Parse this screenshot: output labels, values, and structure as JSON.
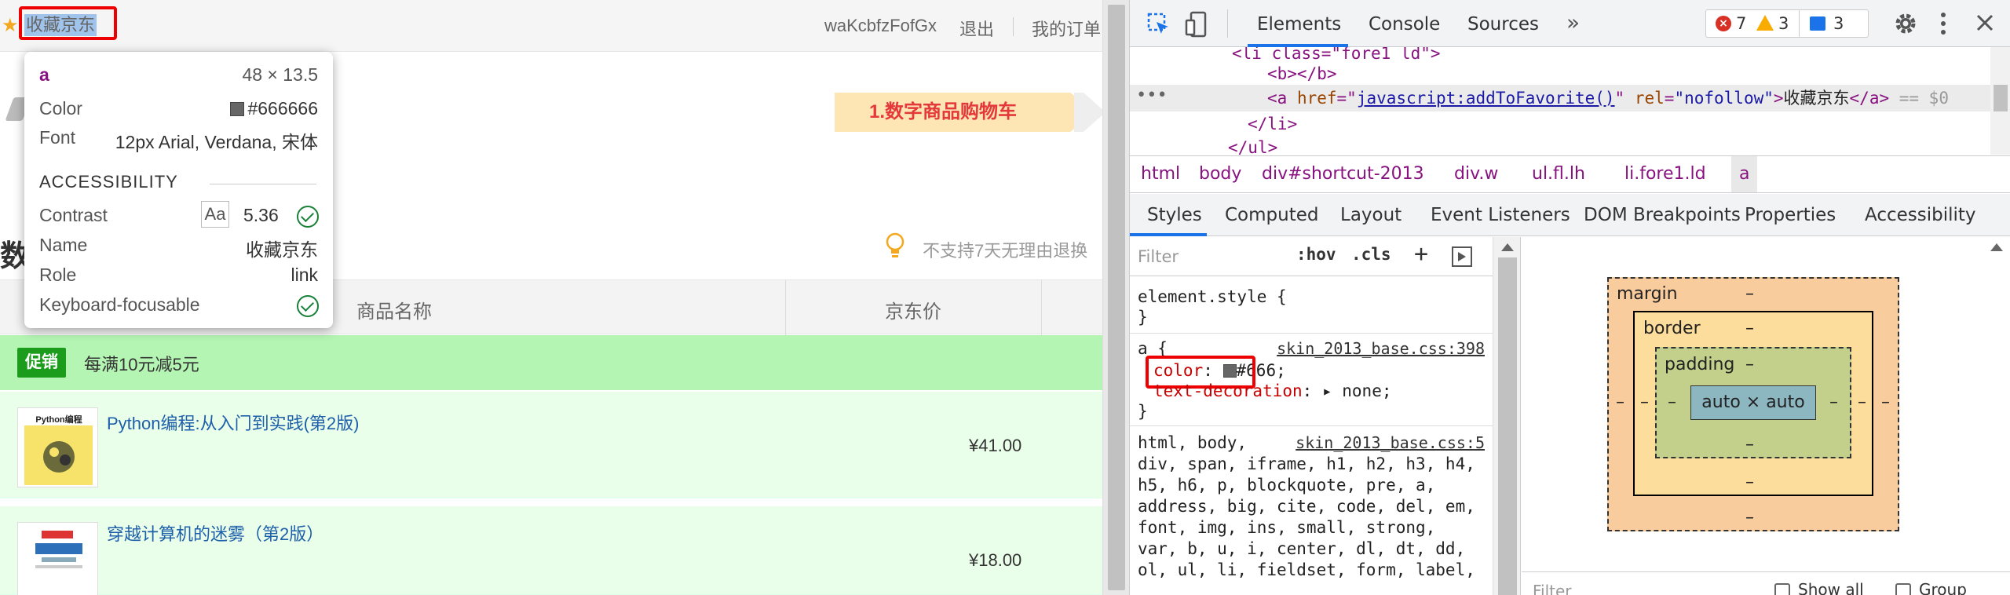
{
  "page": {
    "topbar": {
      "favorite": "收藏京东",
      "user_name": "waKcbfzFofGx",
      "logout": "退出",
      "my_orders": "我的订单"
    },
    "step1": "1.数字商品购物车",
    "section_title": "数",
    "no_return": "不支持7天无理由退换",
    "table": {
      "col_name": "商品名称",
      "col_price": "京东价"
    },
    "promo": {
      "badge": "促销",
      "text": "每满10元减5元"
    },
    "items": [
      {
        "title": "Python编程:从入门到实践(第2版)",
        "price": "¥41.00",
        "thumb_label": "Python编程"
      },
      {
        "title": "穿越计算机的迷雾（第2版）",
        "price": "¥18.00"
      }
    ],
    "tooltip": {
      "tag": "a",
      "size": "48 × 13.5",
      "color_label": "Color",
      "color_value": "#666666",
      "font_label": "Font",
      "font_value": "12px Arial, Verdana, 宋体",
      "accessibility": "ACCESSIBILITY",
      "contrast_label": "Contrast",
      "contrast_aa": "Aa",
      "contrast_value": "5.36",
      "name_label": "Name",
      "name_value": "收藏京东",
      "role_label": "Role",
      "role_value": "link",
      "kf_label": "Keyboard-focusable"
    }
  },
  "devtools": {
    "tabs": [
      "Elements",
      "Console",
      "Sources",
      "»"
    ],
    "errors": "7",
    "warnings": "3",
    "messages": "3",
    "dom": {
      "line1": "<li class=\"fore1 ld\">",
      "line2": "<b></b>",
      "line3_open": "<a ",
      "line3_href_attr": "href",
      "line3_href_val": "javascript:addToFavorite()",
      "line3_rel_attr": "rel",
      "line3_rel_val": "\"nofollow\"",
      "line3_text": "收藏京东",
      "line3_close": "</a>",
      "line3_eq": " == $0",
      "line4": "</li>",
      "line5": "</ul>"
    },
    "breadcrumb": [
      "html",
      "body",
      "div#shortcut-2013",
      "div.w",
      "ul.fl.lh",
      "li.fore1.ld",
      "a"
    ],
    "sub_tabs": [
      "Styles",
      "Computed",
      "Layout",
      "Event Listeners",
      "DOM Breakpoints",
      "Properties",
      "Accessibility"
    ],
    "styles": {
      "filter_placeholder": "Filter",
      "hov": ":hov",
      "cls": ".cls",
      "plus": "+",
      "element_style": "element.style {",
      "close_brace": "}",
      "rule_a_selector": "a {",
      "rule_a_source": "skin_2013_base.css:398",
      "color_prop": "color",
      "color_val": "#666;",
      "td_prop": "text-decoration",
      "td_val": "none;",
      "rule2_sel_1": "html, body,",
      "rule2_source": "skin_2013_base.css:5",
      "rule2_lines": [
        "div, span, iframe, h1, h2, h3, h4,",
        "h5, h6, p, blockquote, pre, a,",
        "address, big, cite, code, del, em,",
        "font, img, ins, small, strong,",
        "var, b, u, i, center, dl, dt, dd,",
        "ol, ul, li, fieldset, form, label,"
      ]
    },
    "box_model": {
      "margin": "margin",
      "border": "border",
      "padding": "padding",
      "content": "auto × auto",
      "dash": "–",
      "filter": "Filter",
      "show_all": "Show all",
      "group": "Group"
    }
  },
  "colors": {
    "accent": "#1a73e8",
    "link_blue": "#1e5faa",
    "promo_green": "#1b9c1b",
    "highlight_red": "#ee0000"
  }
}
